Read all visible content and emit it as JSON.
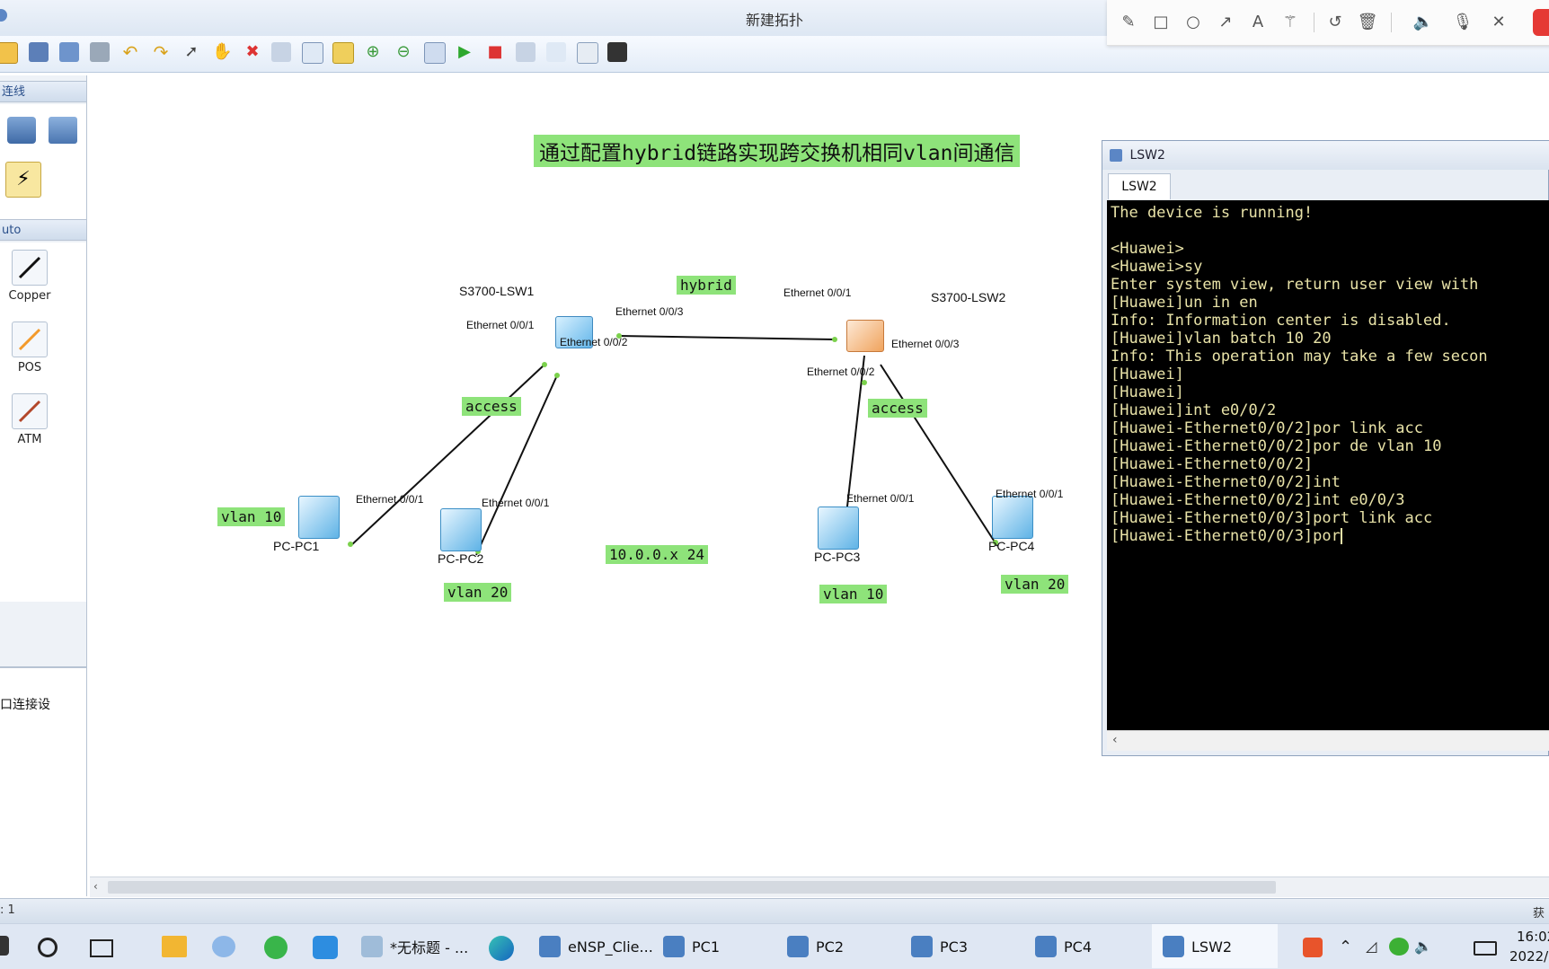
{
  "window": {
    "title": "新建拓扑"
  },
  "left_panel": {
    "section1_header": "连线",
    "section2_header": "uto",
    "cables": [
      {
        "label": "Copper"
      },
      {
        "label": "POS"
      },
      {
        "label": "ATM"
      }
    ],
    "bottom_text": "口连接设"
  },
  "canvas": {
    "banner": "通过配置hybrid链路实现跨交换机相同vlan间通信",
    "labels": {
      "hybrid": "hybrid",
      "access_left": "access",
      "access_right": "access",
      "vlan_pc1": "vlan 10",
      "vlan_pc2": "vlan 20",
      "subnet": "10.0.0.x 24",
      "vlan_pc3": "vlan 10",
      "vlan_pc4": "vlan 20"
    },
    "devices": {
      "lsw1": "S3700-LSW1",
      "lsw2": "S3700-LSW2",
      "pc1": "PC-PC1",
      "pc2": "PC-PC2",
      "pc3": "PC-PC3",
      "pc4": "PC-PC4"
    },
    "ports": {
      "lsw1_e001": "Ethernet 0/0/1",
      "lsw1_e002": "Ethernet 0/0/2",
      "lsw1_e003": "Ethernet 0/0/3",
      "lsw2_e001": "Ethernet 0/0/1",
      "lsw2_e002": "Ethernet 0/0/2",
      "lsw2_e003": "Ethernet 0/0/3",
      "pc1_e001": "Ethernet 0/0/1",
      "pc2_e001": "Ethernet 0/0/1",
      "pc3_e001": "Ethernet 0/0/1",
      "pc4_e001": "Ethernet 0/0/1"
    }
  },
  "terminal": {
    "title": "LSW2",
    "tab": "LSW2",
    "lines": [
      "The device is running!",
      "",
      "<Huawei>",
      "<Huawei>sy",
      "Enter system view, return user view with",
      "[Huawei]un in en",
      "Info: Information center is disabled.",
      "[Huawei]vlan batch 10 20",
      "Info: This operation may take a few secon",
      "[Huawei]",
      "[Huawei]",
      "[Huawei]int e0/0/2",
      "[Huawei-Ethernet0/0/2]por link acc",
      "[Huawei-Ethernet0/0/2]por de vlan 10",
      "[Huawei-Ethernet0/0/2]",
      "[Huawei-Ethernet0/0/2]int",
      "[Huawei-Ethernet0/0/2]int e0/0/3",
      "[Huawei-Ethernet0/0/3]port link acc",
      "[Huawei-Ethernet0/0/3]por"
    ]
  },
  "status_bar": {
    "left": ": 1",
    "right": "获"
  },
  "taskbar": {
    "items": [
      {
        "label": "*无标题 - ..."
      },
      {
        "label": "eNSP_Clie..."
      },
      {
        "label": "PC1"
      },
      {
        "label": "PC2"
      },
      {
        "label": "PC3"
      },
      {
        "label": "PC4"
      },
      {
        "label": "LSW2"
      }
    ],
    "clock_time": "16:02",
    "clock_date": "2022/"
  },
  "colors": {
    "label_green": "#8ee37a",
    "terminal_bg": "#000000",
    "terminal_text": "#e9e3a8",
    "record_red": "#e53935"
  }
}
